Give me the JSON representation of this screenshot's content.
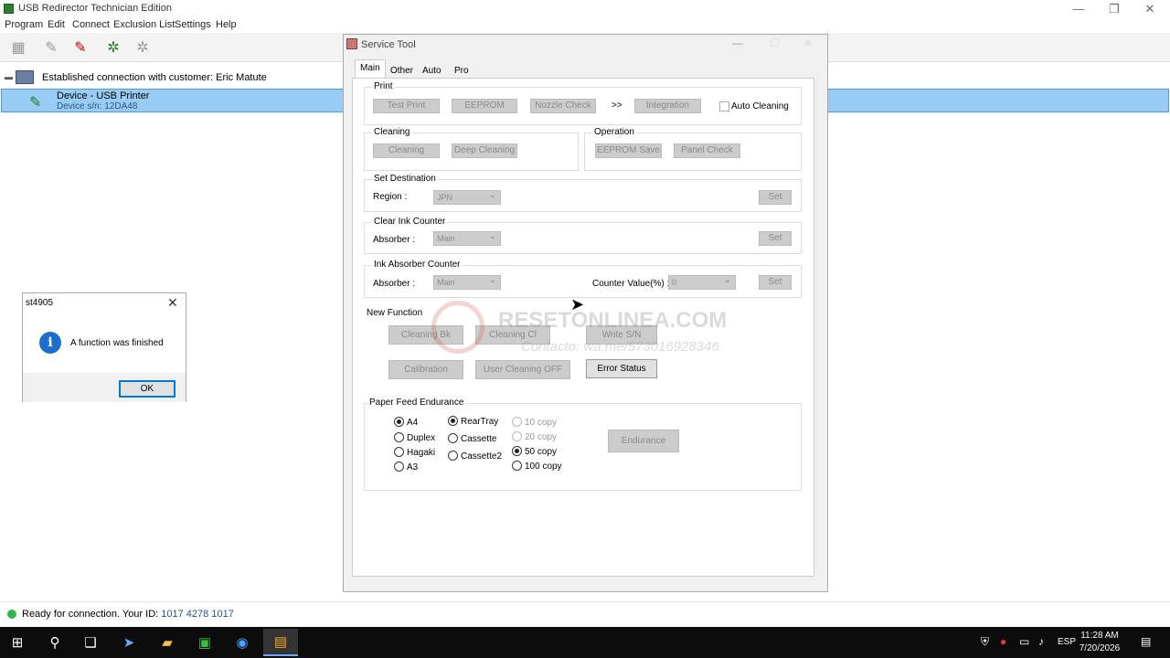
{
  "app": {
    "title": "USB Redirector Technician Edition"
  },
  "menu": [
    "Program",
    "Edit",
    "Connect",
    "Exclusion List",
    "Settings",
    "Help"
  ],
  "tree": {
    "root_label": "Established connection with customer: Eric Matute",
    "device_name": "Device - USB Printer",
    "device_sn": "Device s/n: 12DA48"
  },
  "status": {
    "text": "Ready for connection. Your ID:",
    "id": "1017 4278 1017"
  },
  "message_box": {
    "title": "st4905",
    "text": "A function was finished",
    "ok": "OK"
  },
  "service_tool": {
    "title": "Service Tool",
    "tabs": [
      "Main",
      "Other",
      "Auto",
      "Pro"
    ],
    "print": {
      "label": "Print",
      "test_print": "Test Print",
      "eeprom": "EEPROM",
      "nozzle_check": "Nozzle Check",
      "arrow": ">>",
      "integration": "Integration",
      "auto_cleaning": "Auto Cleaning"
    },
    "cleaning": {
      "label": "Cleaning",
      "cleaning": "Cleaning",
      "deep_cleaning": "Deep Cleaning"
    },
    "operation": {
      "label": "Operation",
      "eeprom_save": "EEPROM Save",
      "panel_check": "Panel Check"
    },
    "set_destination": {
      "label": "Set Destination",
      "region_label": "Region :",
      "region_value": "JPN",
      "set": "Set"
    },
    "clear_ink_counter": {
      "label": "Clear Ink Counter",
      "absorber_label": "Absorber :",
      "absorber_value": "Main",
      "set": "Set"
    },
    "ink_absorber_counter": {
      "label": "Ink Absorber Counter",
      "absorber_label": "Absorber :",
      "absorber_value": "Main",
      "counter_label": "Counter Value(%) :",
      "counter_value": "0",
      "set": "Set"
    },
    "new_function": {
      "label": "New Function",
      "cleaning_bk": "Cleaning Bk",
      "cleaning_cl": "Cleaning Cl",
      "write_sn": "Write S/N",
      "calibration": "Calibration",
      "user_cleaning_off": "User Cleaning OFF",
      "error_status": "Error Status"
    },
    "paper_feed": {
      "label": "Paper Feed Endurance",
      "sizes": [
        "A4",
        "Duplex",
        "Hagaki",
        "A3"
      ],
      "sources": [
        "RearTray",
        "Cassette",
        "Cassette2"
      ],
      "copies": [
        "10 copy",
        "20 copy",
        "50 copy",
        "100 copy"
      ],
      "endurance": "Endurance",
      "selected_size": "A4",
      "selected_source": "RearTray",
      "selected_copy": "50 copy"
    }
  },
  "watermark": {
    "main": "RESETONLINEA.COM",
    "sub": "Contacto: wa.me/573016928346"
  },
  "taskbar": {
    "lang": "ESP",
    "time": "11:28 AM",
    "date": "7/20/2026"
  }
}
